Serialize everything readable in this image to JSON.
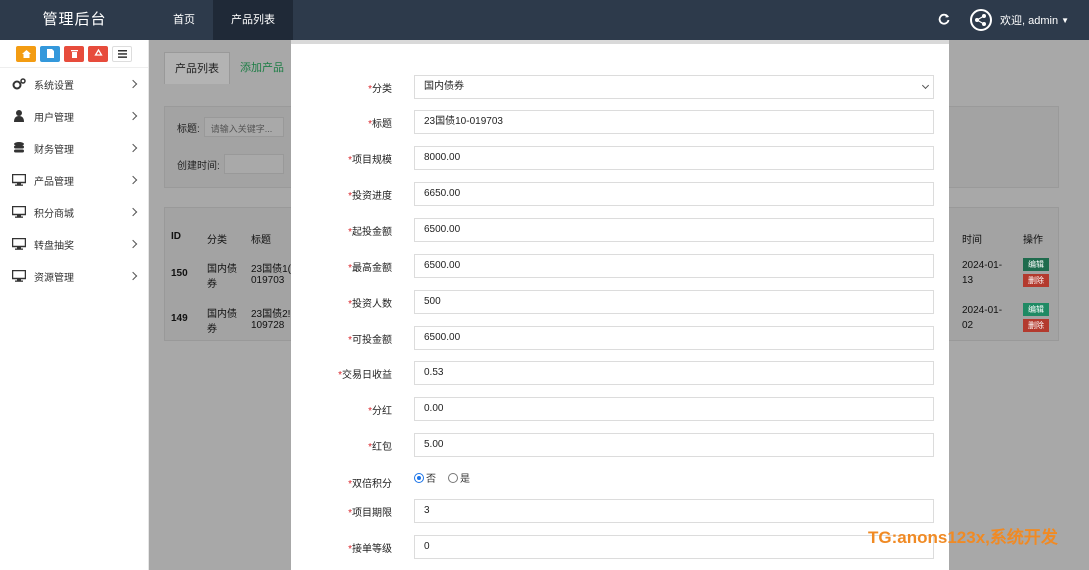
{
  "header": {
    "brand": "管理后台",
    "nav": [
      "首页",
      "产品列表"
    ],
    "user": "欢迎, admin"
  },
  "sidebar": {
    "items": [
      {
        "label": "系统设置",
        "icon": "gears-icon"
      },
      {
        "label": "用户管理",
        "icon": "user-icon"
      },
      {
        "label": "财务管理",
        "icon": "database-icon"
      },
      {
        "label": "产品管理",
        "icon": "monitor-icon"
      },
      {
        "label": "积分商城",
        "icon": "monitor-icon"
      },
      {
        "label": "转盘抽奖",
        "icon": "monitor-icon"
      },
      {
        "label": "资源管理",
        "icon": "monitor-icon"
      }
    ]
  },
  "page": {
    "tabs": [
      "产品列表",
      "添加产品"
    ],
    "search": {
      "title_label": "标题:",
      "title_placeholder": "请输入关键字...",
      "created_label": "创建时间:"
    },
    "table": {
      "headers": {
        "id": "ID",
        "category": "分类",
        "title": "标题",
        "time": "时间",
        "action": "操作"
      },
      "rows": [
        {
          "id": "150",
          "category_1": "国内债",
          "category_2": "券",
          "title_1": "23国债1(",
          "title_2": "019703",
          "time_1": "2024-01-",
          "time_2": "13"
        },
        {
          "id": "149",
          "category_1": "国内债",
          "category_2": "券",
          "title_1": "23国债2!",
          "title_2": "109728",
          "time_1": "2024-01-",
          "time_2": "02"
        }
      ],
      "edit_label": "编辑",
      "delete_label": "删除"
    }
  },
  "form": {
    "fields": [
      {
        "label": "分类",
        "value": "国内债券",
        "type": "select"
      },
      {
        "label": "标题",
        "value": "23国债10-019703"
      },
      {
        "label": "项目规模",
        "value": "8000.00"
      },
      {
        "label": "投资进度",
        "value": "6650.00"
      },
      {
        "label": "起投金额",
        "value": "6500.00"
      },
      {
        "label": "最高金额",
        "value": "6500.00"
      },
      {
        "label": "投资人数",
        "value": "500"
      },
      {
        "label": "可投金额",
        "value": "6500.00"
      },
      {
        "label": "交易日收益",
        "value": "0.53"
      },
      {
        "label": "分红",
        "value": "0.00"
      },
      {
        "label": "红包",
        "value": "5.00"
      },
      {
        "label": "双倍积分",
        "type": "radio",
        "options": [
          "否",
          "是"
        ],
        "selected": "否"
      },
      {
        "label": "项目期限",
        "value": "3"
      },
      {
        "label": "接单等级",
        "value": "0"
      }
    ]
  },
  "watermark": "TG:anons123x,系统开发",
  "colors": {
    "header": "#2d3a4b",
    "required": "#d9252b",
    "edit": "#1e6b4d",
    "delete": "#b33a2e"
  }
}
